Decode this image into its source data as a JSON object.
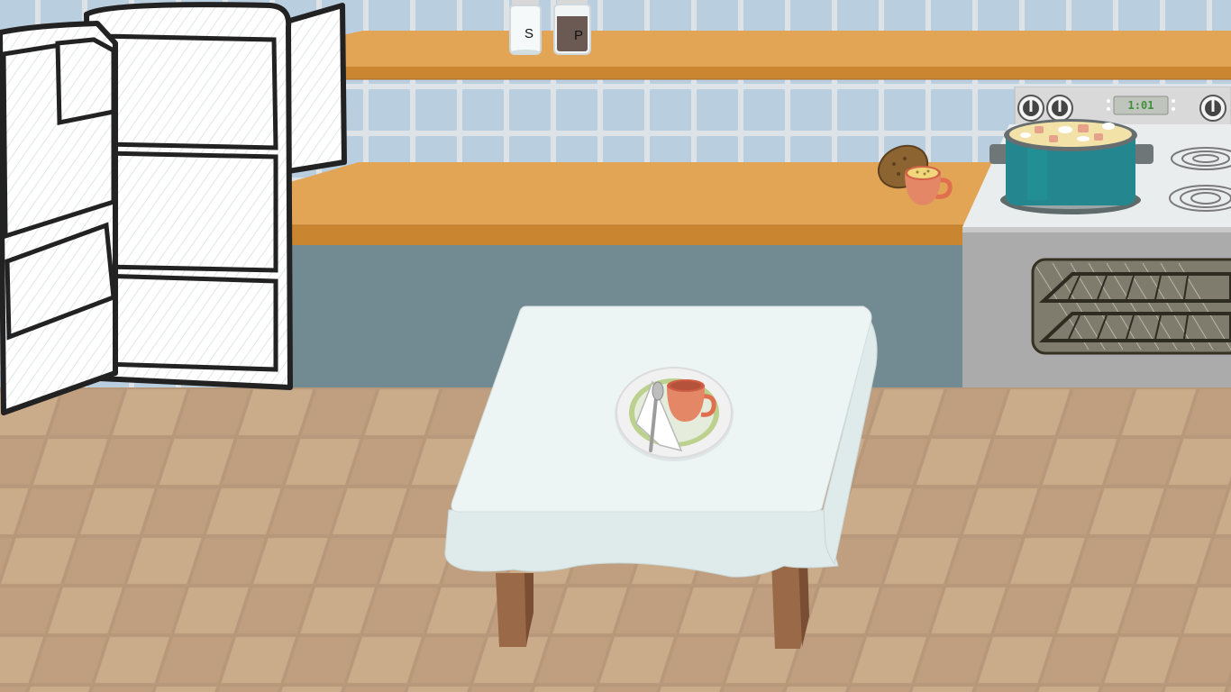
{
  "scene": {
    "name": "kitchen",
    "colors": {
      "wall_tile": "#b9cfe0",
      "grout": "#dde3e7",
      "shelf": "#e2a555",
      "shelf_edge": "#c98530",
      "counter_base": "#728b92",
      "stove": "#aeaeae",
      "pot": "#24878f",
      "tablecloth": "#e9f2f2",
      "table_leg": "#9a6a48",
      "floor_light": "#c9ab89",
      "floor_dark": "#b8987a",
      "cup": "#e06f50"
    }
  },
  "shelf_items": {
    "salt_label": "S",
    "pepper_label": "P"
  },
  "stove": {
    "timer": "1:01"
  }
}
